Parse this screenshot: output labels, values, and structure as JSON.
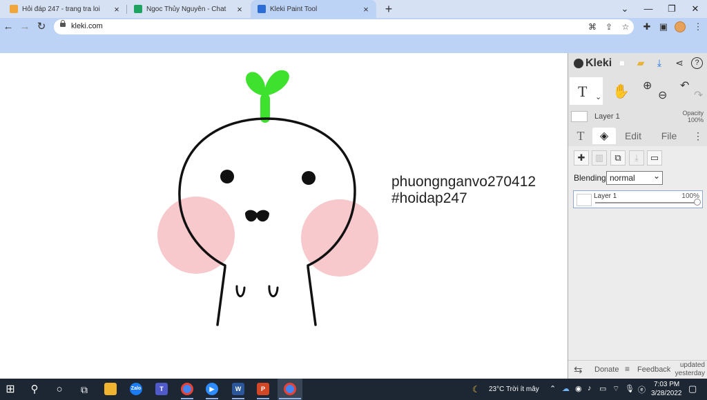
{
  "browser": {
    "tabs": [
      {
        "label": "Hỏi đáp 247 - trang tra loi",
        "favicon_color": "#f0a63a",
        "active": false
      },
      {
        "label": "Ngoc Thủy Nguyễn - Chat",
        "favicon_color": "#1ea361",
        "active": false
      },
      {
        "label": "Kleki Paint Tool",
        "favicon_color": "#2b6cd6",
        "active": true
      }
    ],
    "new_tab_symbol": "+",
    "url": "kleki.com",
    "window_controls": {
      "chevron": "⌄",
      "minimize": "—",
      "restore": "❐",
      "close": "✕"
    }
  },
  "canvas": {
    "text_line1": "phuongnganvo270412",
    "text_line2": "#hoidap247",
    "sprout_color": "#3ee22e",
    "blush_color": "#f7c9cc"
  },
  "panel": {
    "app_name": "Kleki",
    "tools": {
      "text_tool": "T",
      "text_tool_chevron": "⌄"
    },
    "layer_name": "Layer 1",
    "opacity_label": "Opacity",
    "opacity_value": "100%",
    "tabs": {
      "text": "T",
      "edit": "Edit",
      "file": "File"
    },
    "blending_label": "Blending",
    "blending_value": "normal",
    "layer_item": {
      "name": "Layer 1",
      "opacity": "100%",
      "opacity_fraction": 1.0
    },
    "footer": {
      "donate": "Donate",
      "feedback": "Feedback",
      "updated_line1": "updated",
      "updated_line2": "yesterday"
    }
  },
  "taskbar": {
    "weather": "23°C  Trời ít mây",
    "time": "7:03 PM",
    "date": "3/28/2022",
    "zalo_label": "Zalo",
    "word_label": "W",
    "ppt_label": "P"
  }
}
